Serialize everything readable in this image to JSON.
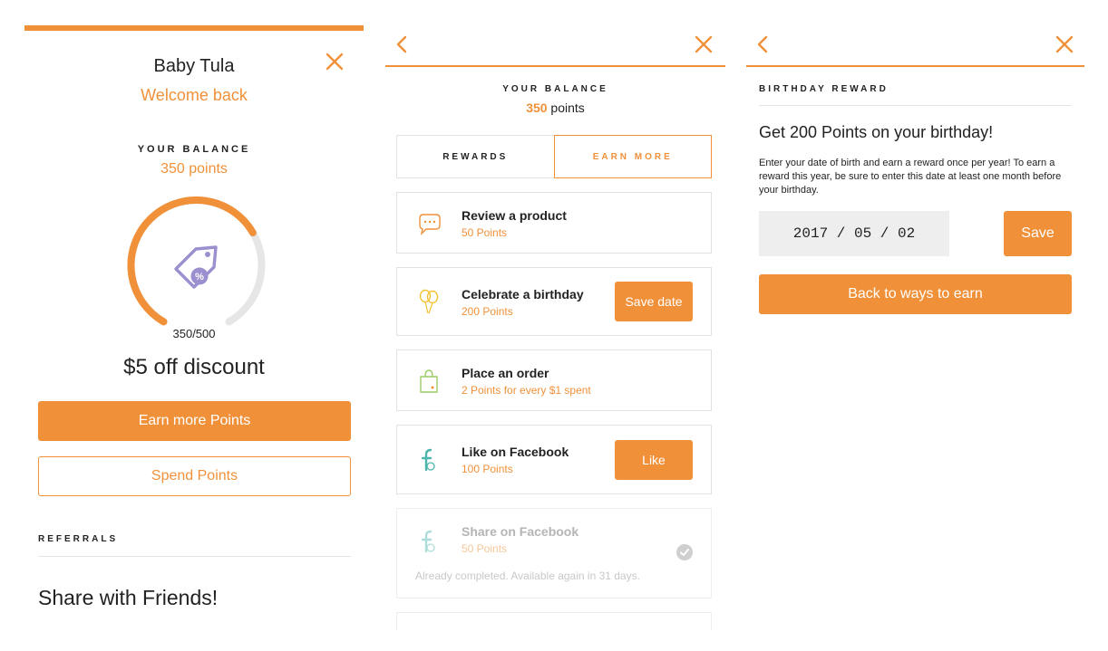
{
  "colors": {
    "accent": "#f0913a",
    "border": "#e2e2e2",
    "gauge_track": "#e6e6e6",
    "icon_purple": "#9b8fd0"
  },
  "panel1": {
    "brand": "Baby Tula",
    "welcome": "Welcome back",
    "balance_label": "YOUR BALANCE",
    "balance_value": "350 points",
    "progress": {
      "current": 350,
      "target": 500,
      "text": "350/500"
    },
    "gauge_icon": "price-tag-percent-icon",
    "reward": "$5 off discount",
    "earn_button": "Earn more Points",
    "spend_button": "Spend Points",
    "referrals_label": "REFERRALS",
    "share_heading": "Share with Friends!"
  },
  "panel2": {
    "balance_label": "YOUR BALANCE",
    "balance_amount": "350",
    "balance_unit": " points",
    "tabs": [
      {
        "label": "REWARDS",
        "active": false
      },
      {
        "label": "EARN MORE",
        "active": true
      }
    ],
    "cards": [
      {
        "title": "Review a product",
        "points": "50 Points",
        "icon": "chat-bubble-icon"
      },
      {
        "title": "Celebrate a birthday",
        "points": "200 Points",
        "icon": "balloons-icon",
        "action": "Save date"
      },
      {
        "title": "Place an order",
        "points": "2 Points for every $1 spent",
        "icon": "shopping-bag-icon"
      },
      {
        "title": "Like on Facebook",
        "points": "100 Points",
        "icon": "facebook-icon",
        "action": "Like"
      },
      {
        "title": "Share on Facebook",
        "points": "50 Points",
        "icon": "facebook-icon",
        "completed": true,
        "note": "Already completed. Available again in 31 days."
      }
    ]
  },
  "panel3": {
    "section_label": "BIRTHDAY REWARD",
    "headline": "Get 200 Points on your birthday!",
    "description": "Enter your date of birth and earn a reward once per year! To earn a reward this year, be sure to enter this date at least one month before your birthday.",
    "date_value": "2017 / 05 / 02",
    "save_button": "Save",
    "back_button": "Back to ways to earn"
  }
}
